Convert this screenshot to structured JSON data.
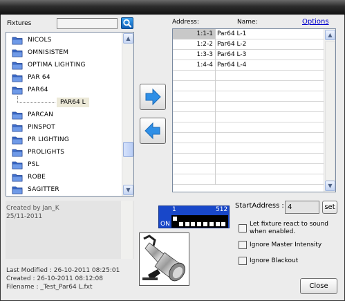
{
  "fixtures_panel": {
    "label": "Fixtures",
    "search_value": "",
    "items": [
      {
        "name": "NICOLS"
      },
      {
        "name": "OMNISISTEM"
      },
      {
        "name": "OPTIMA LIGHTING"
      },
      {
        "name": "PAR 64"
      },
      {
        "name": "PAR64",
        "expanded": true,
        "child": "PAR64 L"
      },
      {
        "name": "PARCAN"
      },
      {
        "name": "PINSPOT"
      },
      {
        "name": "PR LIGHTING"
      },
      {
        "name": "PROLIGHTS"
      },
      {
        "name": "PSL"
      },
      {
        "name": "ROBE"
      },
      {
        "name": "SAGITTER"
      }
    ]
  },
  "info": {
    "created_by": "Created by Jan_K",
    "created_date": "25/11-2011",
    "last_modified": "Last Modified : 26-10-2011 08:25:01",
    "created": "Created : 26-10-2011 08:12:08",
    "filename": "Filename : _Test_Par64 L.fxt"
  },
  "patch_grid": {
    "address_header": "Address:",
    "name_header": "Name:",
    "options_link": "Options",
    "rows": [
      {
        "address": "1:1-1",
        "name": "Par64 L-1"
      },
      {
        "address": "1:2-2",
        "name": "Par64 L-2"
      },
      {
        "address": "1:3-3",
        "name": "Par64 L-3"
      },
      {
        "address": "1:4-4",
        "name": "Par64 L-4"
      }
    ],
    "empty_rows": 11
  },
  "dmx_indicator": {
    "start_label": "1",
    "end_label": "512",
    "on_label": "ON",
    "switches": [
      1,
      0,
      0,
      0,
      0,
      0,
      0,
      0,
      0
    ]
  },
  "start_address": {
    "label": "StartAddress :",
    "value": "4",
    "set_label": "set"
  },
  "options": {
    "sound_label": "Let fixture react to sound when enabled.",
    "sound_checked": false,
    "ignore_master_label": "Ignore Master Intensity",
    "ignore_master_checked": false,
    "ignore_blackout_label": "Ignore Blackout",
    "ignore_blackout_checked": false
  },
  "close_label": "Close",
  "colors": {
    "accent": "#1847c9",
    "arrow": "#2f8fe6",
    "link": "#0000cc"
  }
}
